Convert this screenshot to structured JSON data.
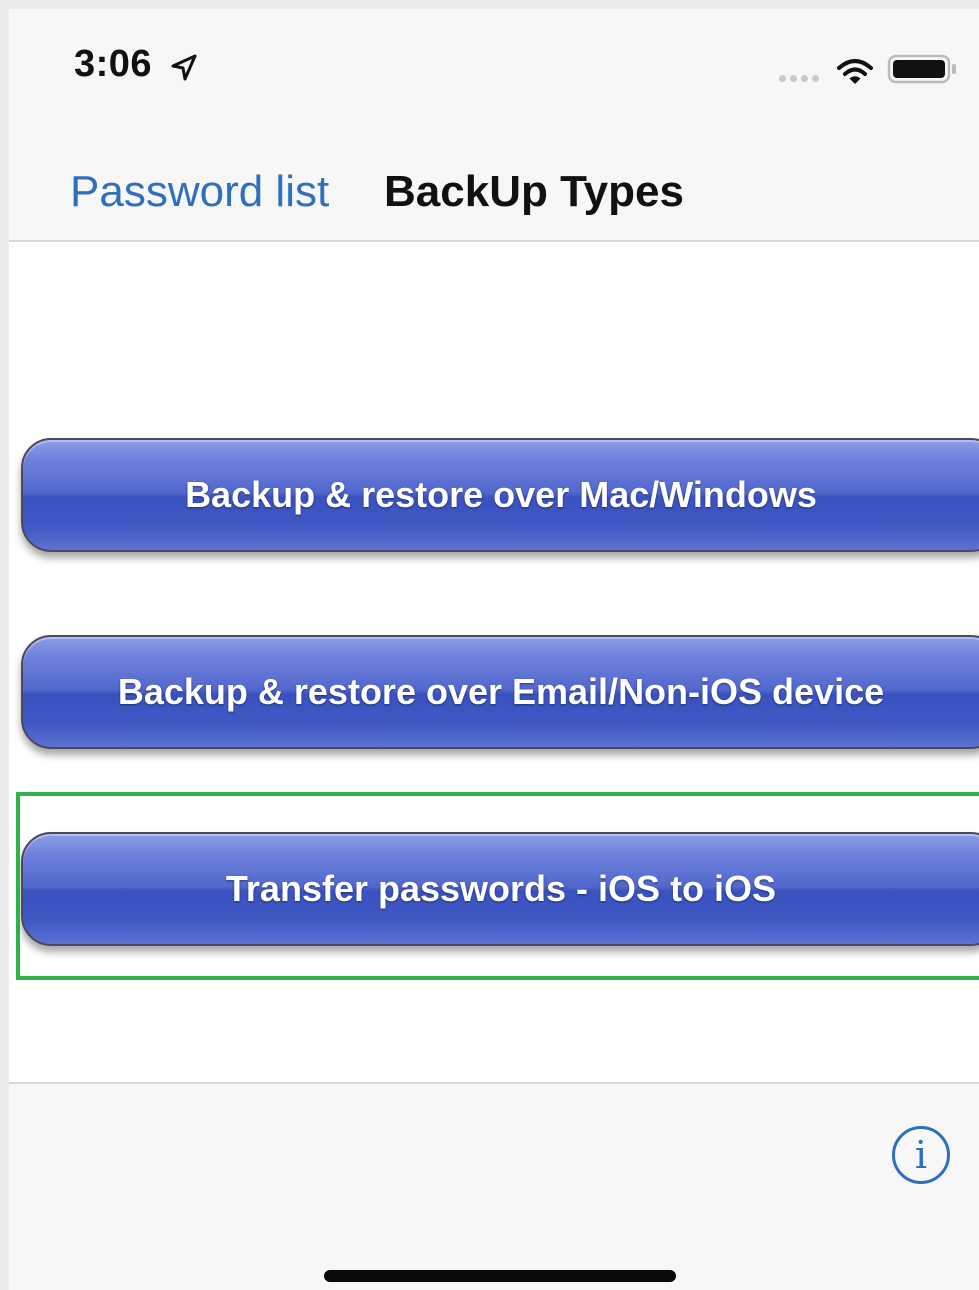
{
  "status_bar": {
    "time": "3:06",
    "location_icon": "location-arrow-icon",
    "signal_icon": "cellular-signal-dots-icon",
    "wifi_icon": "wifi-icon",
    "battery_icon": "battery-icon"
  },
  "nav_bar": {
    "back_label": "Password list",
    "title": "BackUp Types"
  },
  "buttons": [
    {
      "label": "Backup & restore over Mac/Windows"
    },
    {
      "label": "Backup & restore over Email/Non-iOS device"
    },
    {
      "label": "Transfer passwords - iOS to iOS"
    }
  ],
  "toolbar": {
    "info_icon_glyph": "i",
    "info_icon": "info-icon"
  },
  "colors": {
    "accent": "#2f6fbf",
    "button_blue": "#4a60c8",
    "highlight": "#2db34a"
  }
}
